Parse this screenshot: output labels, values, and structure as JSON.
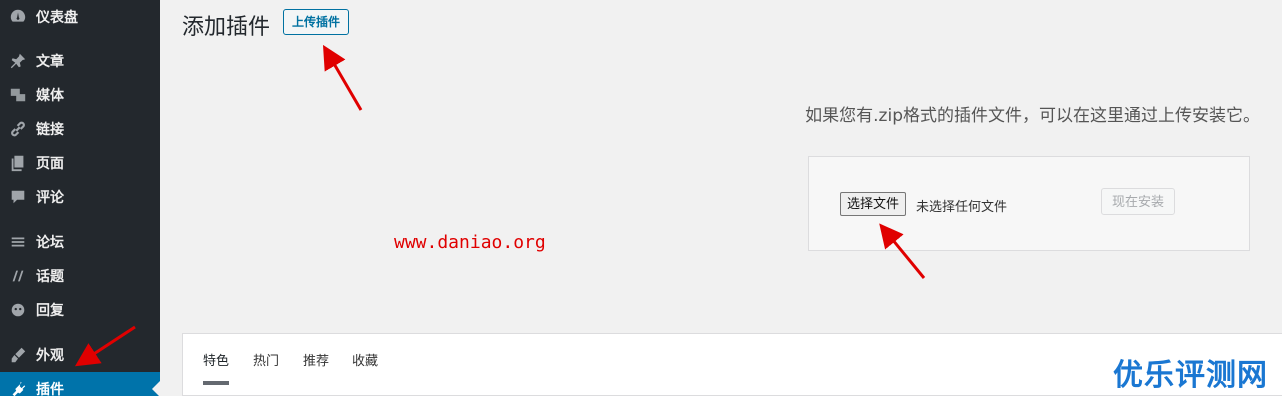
{
  "sidebar": {
    "items": [
      {
        "label": "仪表盘",
        "icon": "dashboard-icon"
      },
      {
        "label": "文章",
        "icon": "pin-icon"
      },
      {
        "label": "媒体",
        "icon": "media-icon"
      },
      {
        "label": "链接",
        "icon": "link-icon"
      },
      {
        "label": "页面",
        "icon": "page-icon"
      },
      {
        "label": "评论",
        "icon": "comment-icon"
      },
      {
        "label": "论坛",
        "icon": "forum-icon"
      },
      {
        "label": "话题",
        "icon": "topic-icon"
      },
      {
        "label": "回复",
        "icon": "reply-icon"
      },
      {
        "label": "外观",
        "icon": "appearance-icon"
      },
      {
        "label": "插件",
        "icon": "plugin-icon",
        "active": true
      }
    ]
  },
  "header": {
    "title": "添加插件",
    "upload_label": "上传插件"
  },
  "upload": {
    "help_text": "如果您有.zip格式的插件文件，可以在这里通过上传安装它。",
    "choose_file_label": "选择文件",
    "no_file_text": "未选择任何文件",
    "install_label": "现在安装"
  },
  "watermark": "www.daniao.org",
  "filter": {
    "tabs": [
      "特色",
      "热门",
      "推荐",
      "收藏"
    ]
  },
  "brand": "优乐评测网",
  "colors": {
    "sidebar_bg": "#23282d",
    "active_bg": "#0073aa",
    "arrow": "#e00000",
    "brand": "#1a77d2"
  }
}
